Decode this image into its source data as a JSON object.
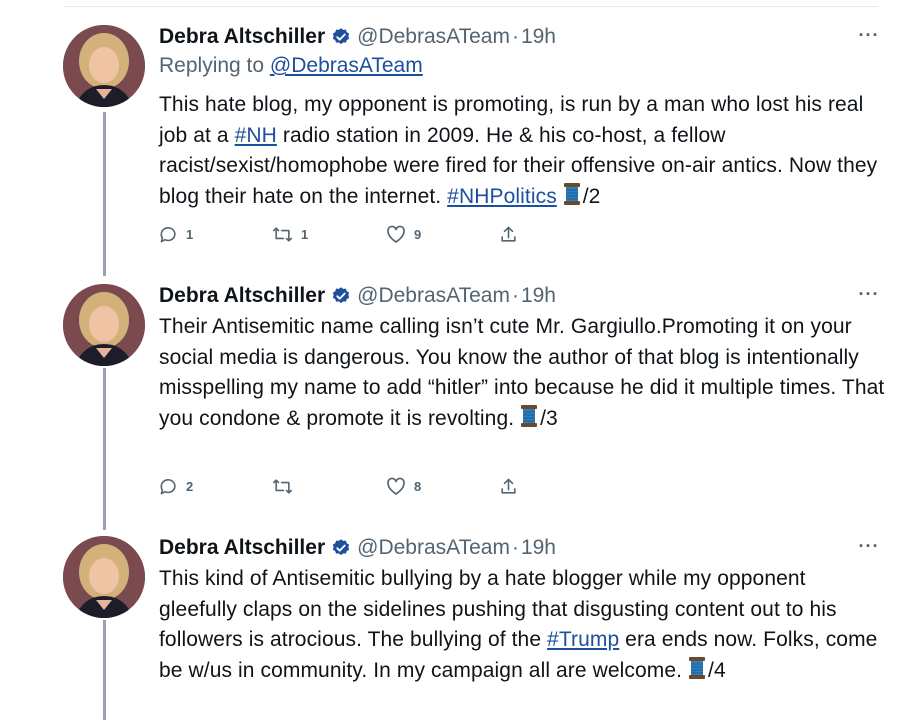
{
  "colors": {
    "link": "#1d4f9c",
    "verified": "#1d4f9c",
    "secondary_text": "#536471",
    "thread_line": "#9aa3ab"
  },
  "icons": {
    "verified": "verified-badge-icon",
    "reply": "reply-icon",
    "retweet": "retweet-icon",
    "like": "heart-icon",
    "share": "share-icon",
    "more": "more-icon",
    "thread": "spool-of-thread-icon"
  },
  "tweets": [
    {
      "name": "Debra Altschiller",
      "handle": "@DebrasATeam",
      "separator": "·",
      "time": "19h",
      "more": "···",
      "reply_prefix": "Replying to",
      "reply_handle": "@DebrasATeam",
      "text_1": "This hate blog, my opponent is promoting, is run by a man who lost his real job at a ",
      "tag_1": "#NH",
      "text_2": " radio station in 2009. He & his co-host, a fellow racist/sexist/homophobe were fired for their offensive on-air antics. Now they blog their hate on the internet. ",
      "tag_2": "#NHPolitics",
      "suffix": "/2",
      "replies": "1",
      "retweets": "1",
      "likes": "9"
    },
    {
      "name": "Debra Altschiller",
      "handle": "@DebrasATeam",
      "separator": "·",
      "time": "19h",
      "more": "···",
      "text_1": "Their Antisemitic name calling isn’t cute Mr. Gargiullo.Promoting it on your social media is dangerous. You know the author of that blog is intentionally misspelling my name to add “hitler” into because he did it multiple times. That you condone & promote it is revolting. ",
      "suffix": "/3",
      "replies": "2",
      "retweets": "",
      "likes": "8"
    },
    {
      "name": "Debra Altschiller",
      "handle": "@DebrasATeam",
      "separator": "·",
      "time": "19h",
      "more": "···",
      "text_1": "This kind of Antisemitic bullying by a hate blogger while my opponent gleefully claps on the sidelines pushing that disgusting content out to his followers is atrocious. The bullying of the ",
      "tag_1": "#Trump",
      "text_2": " era ends now. Folks, come be w/us in community. In my campaign all are welcome. ",
      "suffix": "/4"
    }
  ]
}
